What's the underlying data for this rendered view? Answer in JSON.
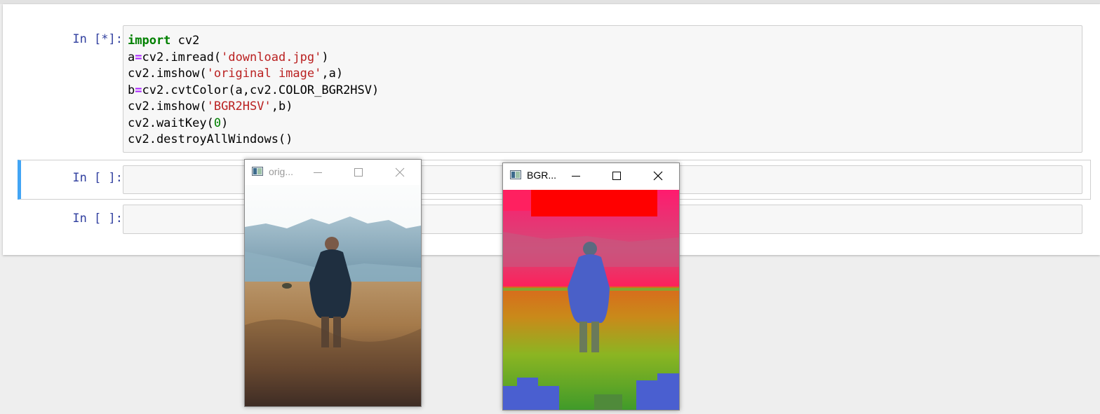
{
  "notebook": {
    "cells": [
      {
        "prompt": "In [*]:",
        "code_lines": [
          "import cv2",
          "a=cv2.imread('download.jpg')",
          "cv2.imshow('original image',a)",
          "b=cv2.cvtColor(a,cv2.COLOR_BGR2HSV)",
          "cv2.imshow('BGR2HSV',b)",
          "cv2.waitKey(0)",
          "cv2.destroyAllWindows()"
        ]
      },
      {
        "prompt": "In [ ]:",
        "code": ""
      },
      {
        "prompt": "In [ ]:",
        "code": ""
      }
    ]
  },
  "windows": {
    "original": {
      "title": "orig...",
      "icon": "opencv-window-icon",
      "focused": false
    },
    "hsv": {
      "title": "BGR...",
      "icon": "opencv-window-icon",
      "focused": true
    }
  },
  "colors": {
    "prompt": "#303f9f",
    "keyword": "#008000",
    "operator": "#aa22ff",
    "string": "#ba2121",
    "selected_cell_border": "#42a5f5"
  }
}
